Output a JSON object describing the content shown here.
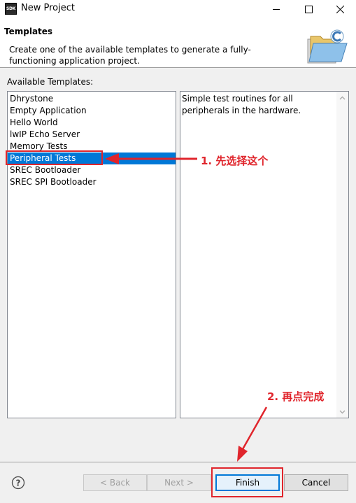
{
  "window": {
    "title": "New Project",
    "app_icon_text": "SDK"
  },
  "header": {
    "title": "Templates",
    "description": "Create one of the available templates to generate a fully-functioning application project."
  },
  "templates": {
    "label": "Available Templates:",
    "items": [
      {
        "label": "Dhrystone",
        "selected": false
      },
      {
        "label": "Empty Application",
        "selected": false
      },
      {
        "label": "Hello World",
        "selected": false
      },
      {
        "label": "lwIP Echo Server",
        "selected": false
      },
      {
        "label": "Memory Tests",
        "selected": false
      },
      {
        "label": "Peripheral Tests",
        "selected": true
      },
      {
        "label": "SREC Bootloader",
        "selected": false
      },
      {
        "label": "SREC SPI Bootloader",
        "selected": false
      }
    ],
    "description": "Simple test routines for all peripherals in the hardware."
  },
  "buttons": {
    "back": "< Back",
    "next": "Next >",
    "finish": "Finish",
    "cancel": "Cancel"
  },
  "annotations": {
    "step1": "1. 先选择这个",
    "step2": "2. 再点完成",
    "color": "#e0252c"
  },
  "colors": {
    "selection": "#0078d7",
    "default_button_border": "#0078d7"
  }
}
